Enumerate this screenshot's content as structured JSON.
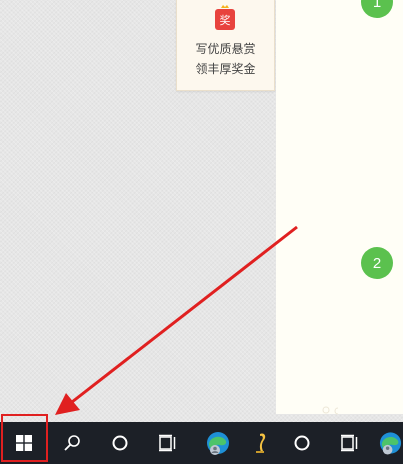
{
  "reward_card": {
    "icon_text": "奖",
    "line1": "写优质悬赏",
    "line2": "领丰厚奖金"
  },
  "steps": {
    "step1": "1",
    "step2": "2"
  },
  "taskbar": {
    "items": [
      {
        "name": "windows-start",
        "icon": "windows-logo-icon"
      },
      {
        "name": "search",
        "icon": "search-icon"
      },
      {
        "name": "cortana",
        "icon": "cortana-ring-icon"
      },
      {
        "name": "task-view",
        "icon": "task-view-icon"
      },
      {
        "name": "edge-browser",
        "icon": "edge-browser-icon"
      },
      {
        "name": "app-pen",
        "icon": "pen-app-icon"
      },
      {
        "name": "cortana-2",
        "icon": "cortana-ring-icon"
      },
      {
        "name": "task-view-2",
        "icon": "task-view-icon"
      },
      {
        "name": "edge-browser-2",
        "icon": "edge-browser-icon"
      }
    ]
  },
  "colors": {
    "badge_green": "#5bc14e",
    "annotation_red": "#e02020",
    "taskbar_bg": "#1c2027"
  }
}
